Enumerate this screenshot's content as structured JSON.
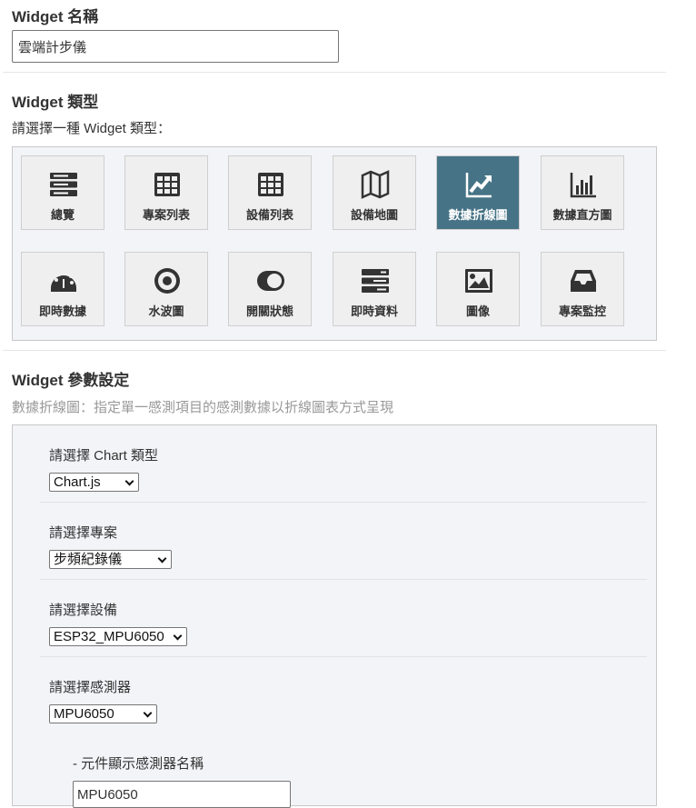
{
  "name_section": {
    "title": "Widget 名稱",
    "value": "雲端計步儀"
  },
  "type_section": {
    "title": "Widget 類型",
    "prompt": "請選擇一種 Widget 類型：",
    "tiles": [
      {
        "label": "總覽",
        "icon": "server-stack-icon"
      },
      {
        "label": "專案列表",
        "icon": "table-icon"
      },
      {
        "label": "設備列表",
        "icon": "table-icon"
      },
      {
        "label": "設備地圖",
        "icon": "map-icon"
      },
      {
        "label": "數據折線圖",
        "icon": "line-chart-icon",
        "selected": true
      },
      {
        "label": "數據直方圖",
        "icon": "bar-chart-icon"
      },
      {
        "label": "即時數據",
        "icon": "gauge-icon"
      },
      {
        "label": "水波圖",
        "icon": "dot-circle-icon"
      },
      {
        "label": "開關狀態",
        "icon": "toggle-icon"
      },
      {
        "label": "即時資料",
        "icon": "server-icon"
      },
      {
        "label": "圖像",
        "icon": "image-icon"
      },
      {
        "label": "專案監控",
        "icon": "inbox-icon"
      }
    ],
    "accent": "#467386"
  },
  "params": {
    "title": "Widget 參數設定",
    "description": "數據折線圖：指定單一感測項目的感測數據以折線圖表方式呈現",
    "chart_type": {
      "label": "請選擇 Chart 類型",
      "value": "Chart.js"
    },
    "project": {
      "label": "請選擇專案",
      "value": "步頻紀錄儀"
    },
    "device": {
      "label": "請選擇設備",
      "value": "ESP32_MPU6050"
    },
    "sensor": {
      "label": "請選擇感測器",
      "value": "MPU6050"
    },
    "display_name": {
      "label": "- 元件顯示感測器名稱",
      "value": "MPU6050"
    }
  }
}
